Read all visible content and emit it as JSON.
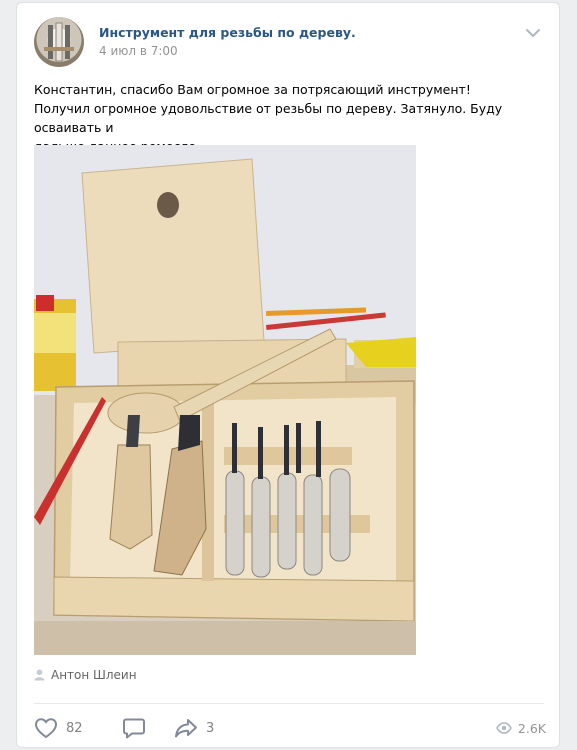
{
  "post": {
    "group_name": "Инструмент для резьбы по дереву.",
    "date": "4 июл в 7:00",
    "text_lines": [
      "Константин, спасибо Вам огромное за потрясающий инструмент!",
      "Получил огромное удовольствие от резьбы по дереву. Затянуло. Буду осваивать и",
      "дальше данное ремесло."
    ],
    "author": "Антон Шлеин",
    "likes": "82",
    "comments": "",
    "shares": "3",
    "views": "2.6K"
  },
  "icons": {
    "avatar": "group-avatar",
    "menu": "chevron-down-icon",
    "author": "user-icon",
    "like": "heart-icon",
    "comment": "comment-icon",
    "share": "share-icon",
    "views": "eye-icon"
  },
  "colors": {
    "link": "#2a5885",
    "muted": "#939393",
    "background": "#edeef0"
  }
}
